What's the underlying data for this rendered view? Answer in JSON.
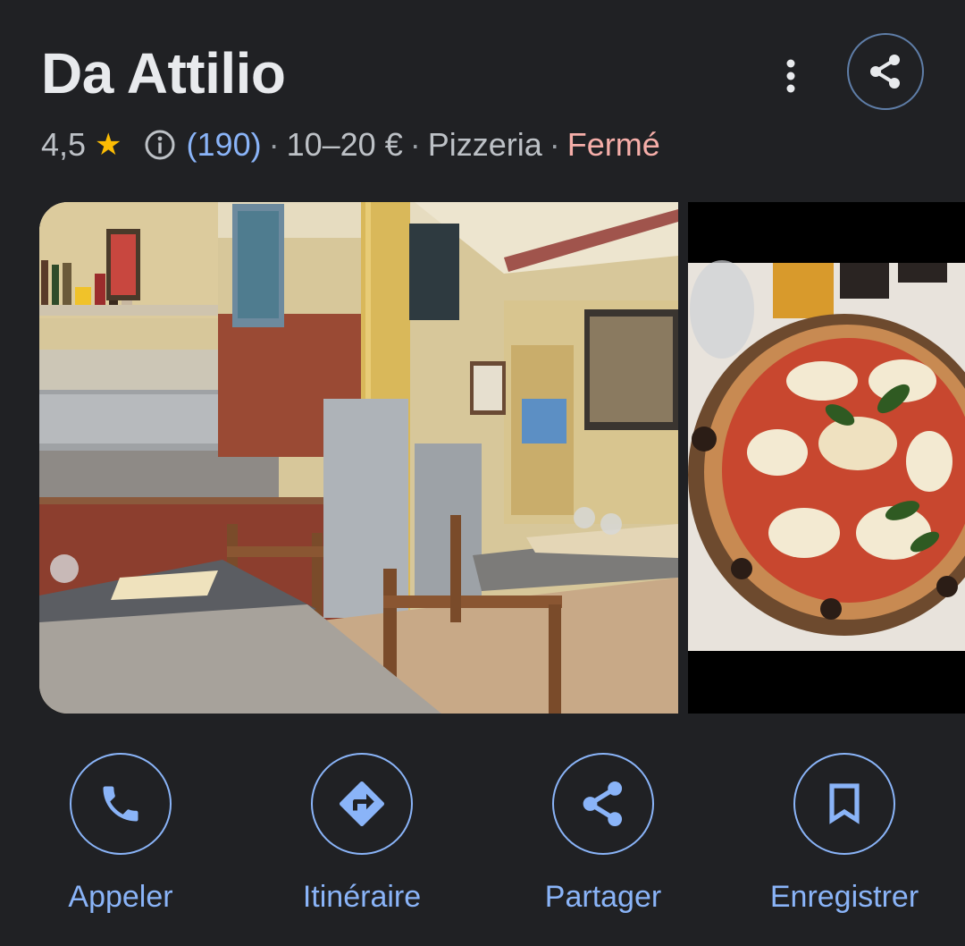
{
  "place": {
    "name": "Da Attilio",
    "rating": "4,5",
    "reviews": "(190)",
    "price": "10–20 €",
    "category": "Pizzeria",
    "status": "Fermé",
    "separator": "·"
  },
  "icons": {
    "more": "more-vert-icon",
    "share": "share-icon",
    "star": "star-icon",
    "info": "info-icon",
    "phone": "phone-icon",
    "directions": "directions-icon",
    "bookmark": "bookmark-icon"
  },
  "actions": [
    {
      "label": "Appeler"
    },
    {
      "label": "Itinéraire"
    },
    {
      "label": "Partager"
    },
    {
      "label": "Enregistrer"
    }
  ],
  "colors": {
    "background": "#202124",
    "accent": "#8ab4f8",
    "star": "#fbbc04",
    "closed": "#f6aea9"
  }
}
